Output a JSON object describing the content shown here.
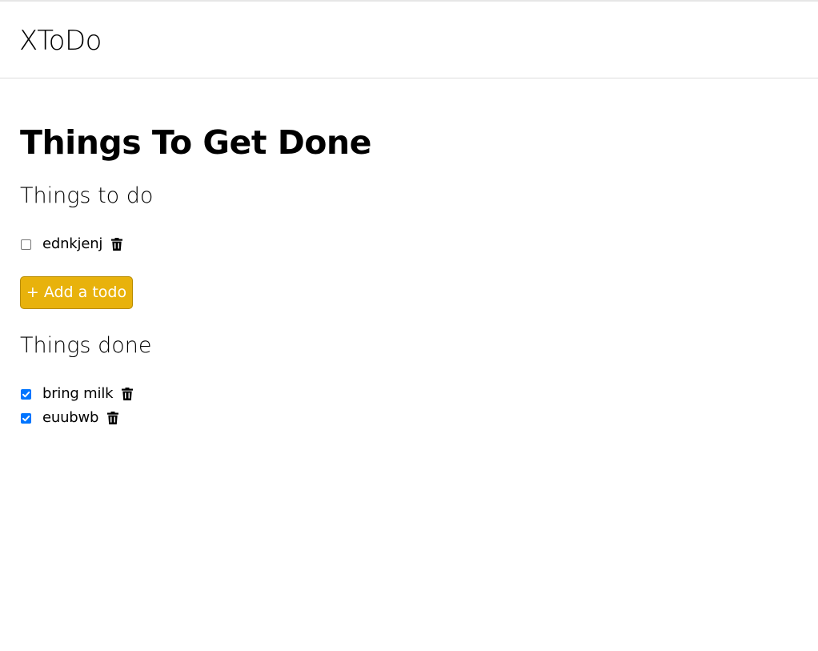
{
  "navbar": {
    "brand": "XToDo"
  },
  "main": {
    "title": "Things To Get Done",
    "todo_section": {
      "heading": "Things to do",
      "items": [
        {
          "label": "ednkjenj",
          "checked": false
        }
      ]
    },
    "add_button_label": "+ Add a todo",
    "done_section": {
      "heading": "Things done",
      "items": [
        {
          "label": "bring milk",
          "checked": true
        },
        {
          "label": "euubwb",
          "checked": true
        }
      ]
    }
  },
  "icons": {
    "delete": "trash-icon",
    "checkbox_checked": "checkmark-icon"
  },
  "colors": {
    "button_bg": "#e8b20c",
    "button_border": "#b88c00",
    "checkbox_accent": "#0075ff"
  }
}
